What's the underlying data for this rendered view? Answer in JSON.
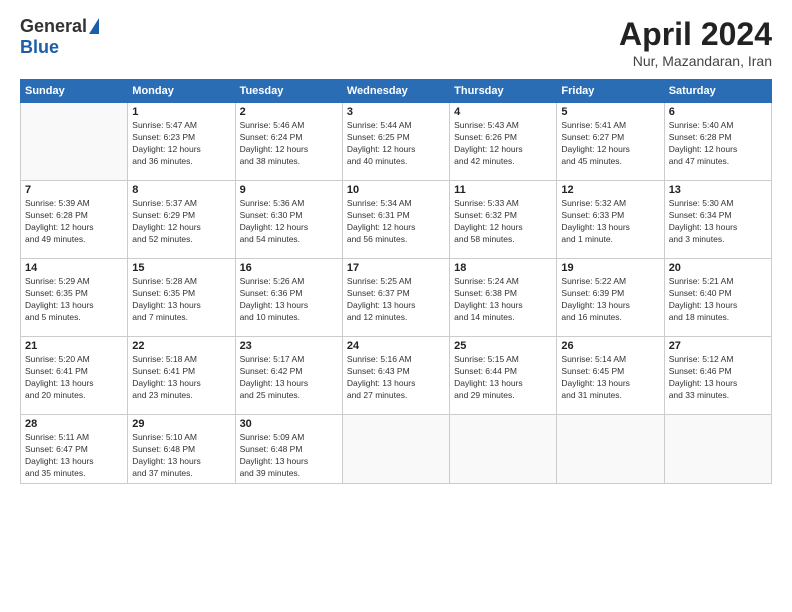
{
  "logo": {
    "general": "General",
    "blue": "Blue"
  },
  "title": "April 2024",
  "subtitle": "Nur, Mazandaran, Iran",
  "days_header": [
    "Sunday",
    "Monday",
    "Tuesday",
    "Wednesday",
    "Thursday",
    "Friday",
    "Saturday"
  ],
  "weeks": [
    [
      {
        "day": "",
        "info": ""
      },
      {
        "day": "1",
        "info": "Sunrise: 5:47 AM\nSunset: 6:23 PM\nDaylight: 12 hours\nand 36 minutes."
      },
      {
        "day": "2",
        "info": "Sunrise: 5:46 AM\nSunset: 6:24 PM\nDaylight: 12 hours\nand 38 minutes."
      },
      {
        "day": "3",
        "info": "Sunrise: 5:44 AM\nSunset: 6:25 PM\nDaylight: 12 hours\nand 40 minutes."
      },
      {
        "day": "4",
        "info": "Sunrise: 5:43 AM\nSunset: 6:26 PM\nDaylight: 12 hours\nand 42 minutes."
      },
      {
        "day": "5",
        "info": "Sunrise: 5:41 AM\nSunset: 6:27 PM\nDaylight: 12 hours\nand 45 minutes."
      },
      {
        "day": "6",
        "info": "Sunrise: 5:40 AM\nSunset: 6:28 PM\nDaylight: 12 hours\nand 47 minutes."
      }
    ],
    [
      {
        "day": "7",
        "info": "Sunrise: 5:39 AM\nSunset: 6:28 PM\nDaylight: 12 hours\nand 49 minutes."
      },
      {
        "day": "8",
        "info": "Sunrise: 5:37 AM\nSunset: 6:29 PM\nDaylight: 12 hours\nand 52 minutes."
      },
      {
        "day": "9",
        "info": "Sunrise: 5:36 AM\nSunset: 6:30 PM\nDaylight: 12 hours\nand 54 minutes."
      },
      {
        "day": "10",
        "info": "Sunrise: 5:34 AM\nSunset: 6:31 PM\nDaylight: 12 hours\nand 56 minutes."
      },
      {
        "day": "11",
        "info": "Sunrise: 5:33 AM\nSunset: 6:32 PM\nDaylight: 12 hours\nand 58 minutes."
      },
      {
        "day": "12",
        "info": "Sunrise: 5:32 AM\nSunset: 6:33 PM\nDaylight: 13 hours\nand 1 minute."
      },
      {
        "day": "13",
        "info": "Sunrise: 5:30 AM\nSunset: 6:34 PM\nDaylight: 13 hours\nand 3 minutes."
      }
    ],
    [
      {
        "day": "14",
        "info": "Sunrise: 5:29 AM\nSunset: 6:35 PM\nDaylight: 13 hours\nand 5 minutes."
      },
      {
        "day": "15",
        "info": "Sunrise: 5:28 AM\nSunset: 6:35 PM\nDaylight: 13 hours\nand 7 minutes."
      },
      {
        "day": "16",
        "info": "Sunrise: 5:26 AM\nSunset: 6:36 PM\nDaylight: 13 hours\nand 10 minutes."
      },
      {
        "day": "17",
        "info": "Sunrise: 5:25 AM\nSunset: 6:37 PM\nDaylight: 13 hours\nand 12 minutes."
      },
      {
        "day": "18",
        "info": "Sunrise: 5:24 AM\nSunset: 6:38 PM\nDaylight: 13 hours\nand 14 minutes."
      },
      {
        "day": "19",
        "info": "Sunrise: 5:22 AM\nSunset: 6:39 PM\nDaylight: 13 hours\nand 16 minutes."
      },
      {
        "day": "20",
        "info": "Sunrise: 5:21 AM\nSunset: 6:40 PM\nDaylight: 13 hours\nand 18 minutes."
      }
    ],
    [
      {
        "day": "21",
        "info": "Sunrise: 5:20 AM\nSunset: 6:41 PM\nDaylight: 13 hours\nand 20 minutes."
      },
      {
        "day": "22",
        "info": "Sunrise: 5:18 AM\nSunset: 6:41 PM\nDaylight: 13 hours\nand 23 minutes."
      },
      {
        "day": "23",
        "info": "Sunrise: 5:17 AM\nSunset: 6:42 PM\nDaylight: 13 hours\nand 25 minutes."
      },
      {
        "day": "24",
        "info": "Sunrise: 5:16 AM\nSunset: 6:43 PM\nDaylight: 13 hours\nand 27 minutes."
      },
      {
        "day": "25",
        "info": "Sunrise: 5:15 AM\nSunset: 6:44 PM\nDaylight: 13 hours\nand 29 minutes."
      },
      {
        "day": "26",
        "info": "Sunrise: 5:14 AM\nSunset: 6:45 PM\nDaylight: 13 hours\nand 31 minutes."
      },
      {
        "day": "27",
        "info": "Sunrise: 5:12 AM\nSunset: 6:46 PM\nDaylight: 13 hours\nand 33 minutes."
      }
    ],
    [
      {
        "day": "28",
        "info": "Sunrise: 5:11 AM\nSunset: 6:47 PM\nDaylight: 13 hours\nand 35 minutes."
      },
      {
        "day": "29",
        "info": "Sunrise: 5:10 AM\nSunset: 6:48 PM\nDaylight: 13 hours\nand 37 minutes."
      },
      {
        "day": "30",
        "info": "Sunrise: 5:09 AM\nSunset: 6:48 PM\nDaylight: 13 hours\nand 39 minutes."
      },
      {
        "day": "",
        "info": ""
      },
      {
        "day": "",
        "info": ""
      },
      {
        "day": "",
        "info": ""
      },
      {
        "day": "",
        "info": ""
      }
    ]
  ]
}
